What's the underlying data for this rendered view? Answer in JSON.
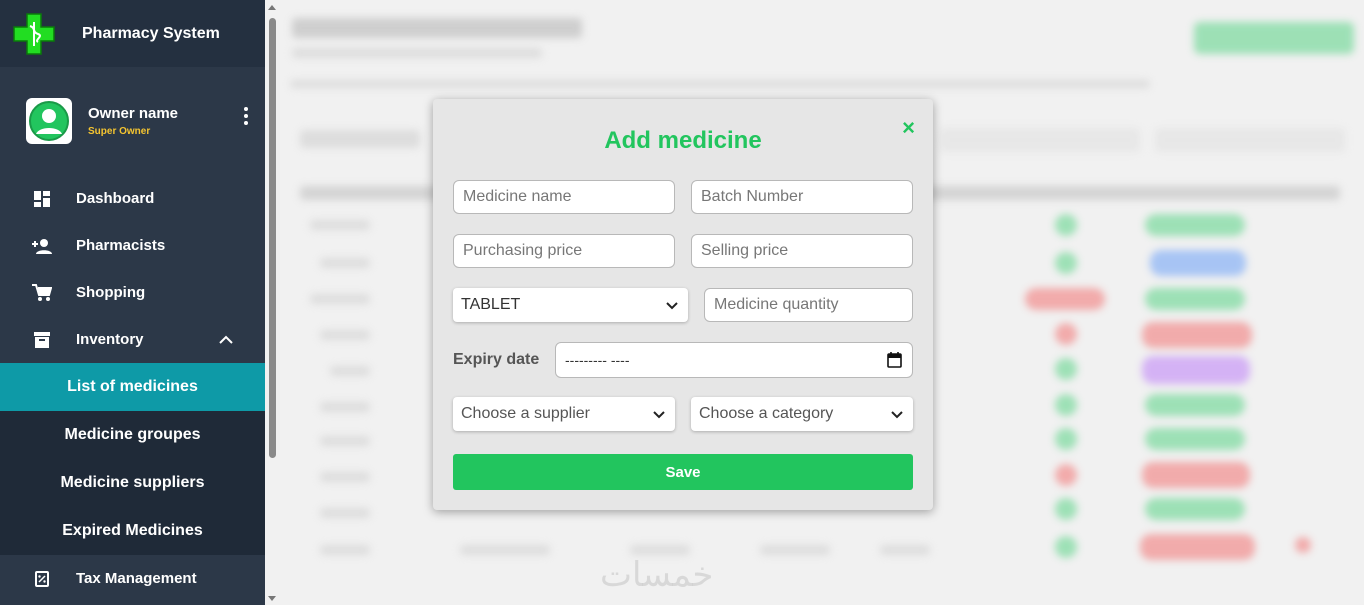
{
  "brand": {
    "title": "Pharmacy System"
  },
  "profile": {
    "name": "Owner name",
    "role": "Super Owner"
  },
  "nav": {
    "dashboard": "Dashboard",
    "pharmacists": "Pharmacists",
    "shopping": "Shopping",
    "inventory": "Inventory",
    "sub": {
      "list": "List of medicines",
      "groups": "Medicine groupes",
      "suppliers": "Medicine suppliers",
      "expired": "Expired Medicines"
    },
    "tax": "Tax Management"
  },
  "modal": {
    "title": "Add medicine",
    "close": "×",
    "medicine_name_placeholder": "Medicine name",
    "batch_number_placeholder": "Batch Number",
    "purchasing_price_placeholder": "Purchasing price",
    "selling_price_placeholder": "Selling price",
    "type_selected": "TABLET",
    "quantity_placeholder": "Medicine quantity",
    "expiry_label": "Expiry date",
    "expiry_value": "---------  ----",
    "supplier_selected": "Choose a supplier",
    "category_selected": "Choose a category",
    "save_label": "Save"
  },
  "watermark": "خمسات",
  "colors": {
    "accent": "#22c55e",
    "active": "#0e9aa7",
    "sidebar": "#2c3848"
  }
}
